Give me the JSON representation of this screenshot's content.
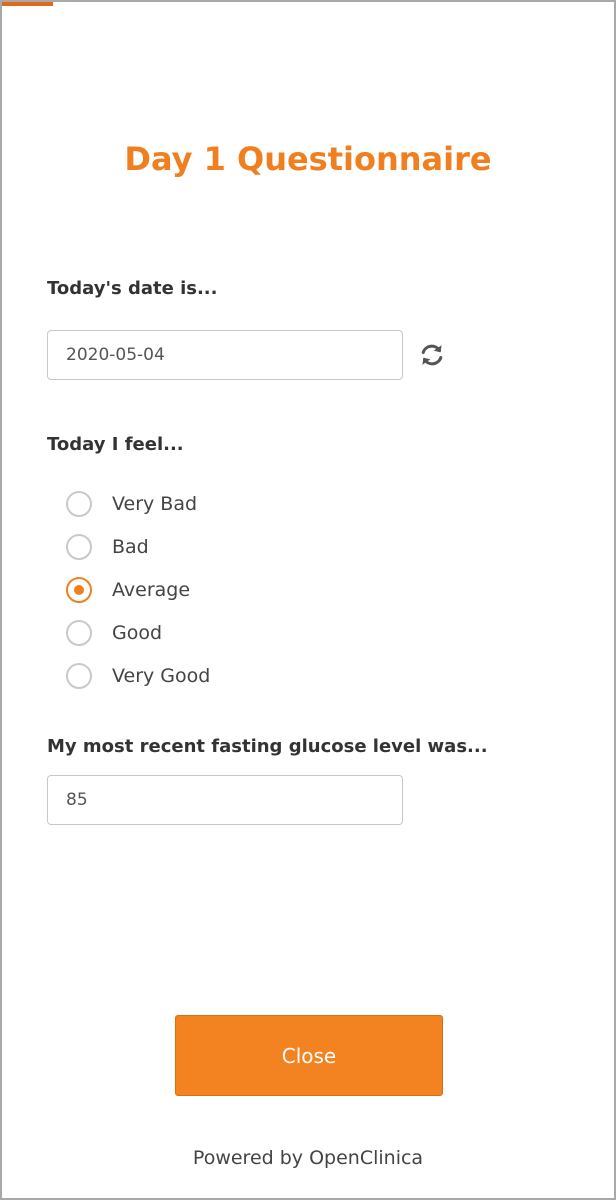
{
  "form": {
    "title": "Day 1 Questionnaire",
    "accent_color": "#f0801f",
    "progress_color": "#e06a1c"
  },
  "questions": {
    "date": {
      "label": "Today's date is...",
      "value": "2020-05-04",
      "refresh_icon": "refresh-icon"
    },
    "feeling": {
      "label": "Today I feel...",
      "selected": "Average",
      "options": [
        {
          "label": "Very Bad",
          "checked": false
        },
        {
          "label": "Bad",
          "checked": false
        },
        {
          "label": "Average",
          "checked": true
        },
        {
          "label": "Good",
          "checked": false
        },
        {
          "label": "Very Good",
          "checked": false
        }
      ]
    },
    "glucose": {
      "label": "My most recent fasting glucose level was...",
      "value": "85"
    }
  },
  "actions": {
    "close_label": "Close",
    "button_color": "#f38221"
  },
  "footer": {
    "text": "Powered by OpenClinica"
  }
}
